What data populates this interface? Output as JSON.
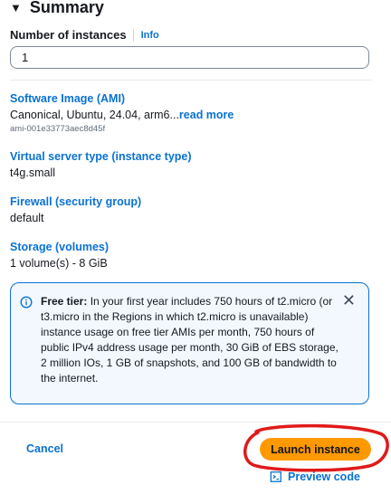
{
  "summary": {
    "caret": "▼",
    "title": "Summary"
  },
  "instances": {
    "label": "Number of instances",
    "info": "Info",
    "value": "1"
  },
  "ami": {
    "title": "Software Image (AMI)",
    "value": "Canonical, Ubuntu, 24.04, arm6...",
    "read_more": "read more",
    "id": "ami-001e33773aec8d45f"
  },
  "instance_type": {
    "title": "Virtual server type (instance type)",
    "value": "t4g.small"
  },
  "firewall": {
    "title": "Firewall (security group)",
    "value": "default"
  },
  "storage": {
    "title": "Storage (volumes)",
    "value": "1 volume(s) - 8 GiB"
  },
  "free_tier": {
    "heading": "Free tier:",
    "text": " In your first year includes 750 hours of t2.micro (or t3.micro in the Regions in which t2.micro is unavailable) instance usage on free tier AMIs per month, 750 hours of public IPv4 address usage per month, 30 GiB of EBS storage, 2 million IOs, 1 GB of snapshots, and 100 GB of bandwidth to the internet.",
    "close": "✕"
  },
  "actions": {
    "cancel": "Cancel",
    "launch": "Launch instance",
    "preview": "Preview code"
  },
  "colors": {
    "link": "#0972d3",
    "launch_button": "#ff9900",
    "annotation": "#e01a1a",
    "info_box_bg": "#f2f8fd"
  }
}
